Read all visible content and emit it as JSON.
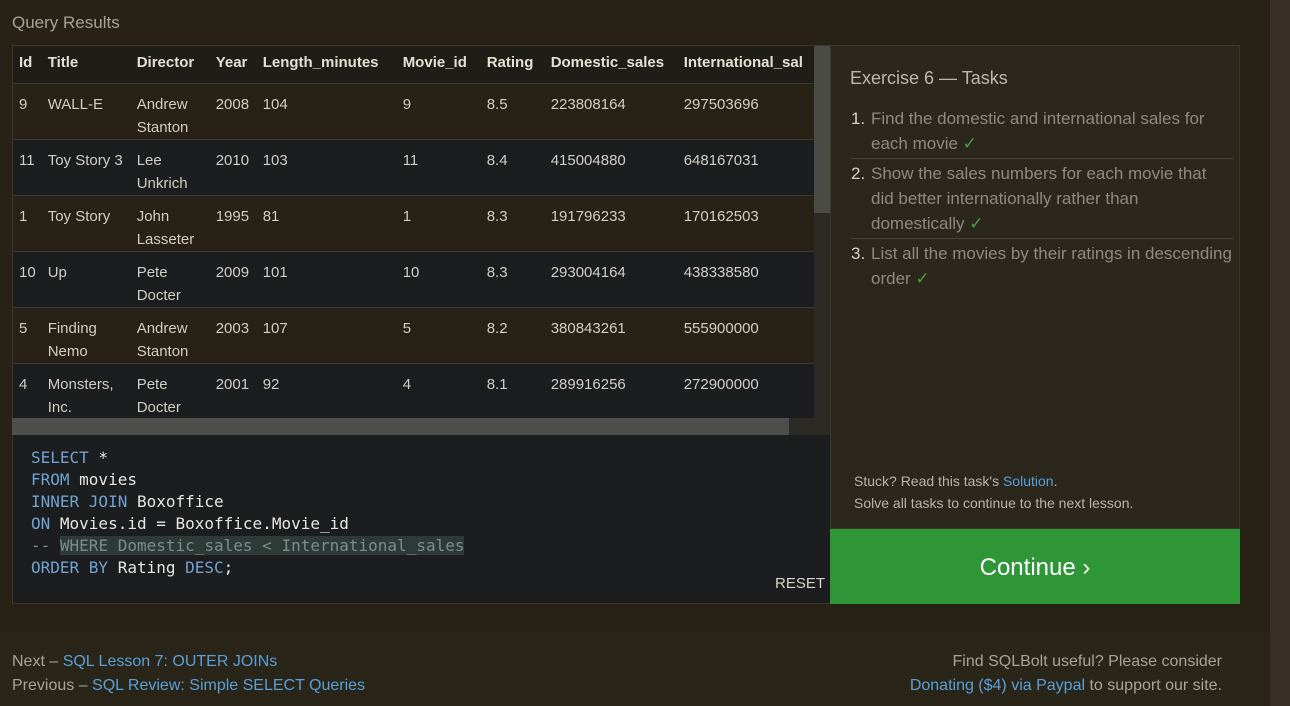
{
  "query_results_title": "Query Results",
  "table": {
    "headers": [
      "Id",
      "Title",
      "Director",
      "Year",
      "Length_minutes",
      "Movie_id",
      "Rating",
      "Domestic_sales",
      "International_sal"
    ],
    "rows": [
      [
        "9",
        "WALL-E",
        "Andrew Stanton",
        "2008",
        "104",
        "9",
        "8.5",
        "223808164",
        "297503696"
      ],
      [
        "11",
        "Toy Story 3",
        "Lee Unkrich",
        "2010",
        "103",
        "11",
        "8.4",
        "415004880",
        "648167031"
      ],
      [
        "1",
        "Toy Story",
        "John Lasseter",
        "1995",
        "81",
        "1",
        "8.3",
        "191796233",
        "170162503"
      ],
      [
        "10",
        "Up",
        "Pete Docter",
        "2009",
        "101",
        "10",
        "8.3",
        "293004164",
        "438338580"
      ],
      [
        "5",
        "Finding Nemo",
        "Andrew Stanton",
        "2003",
        "107",
        "5",
        "8.2",
        "380843261",
        "555900000"
      ],
      [
        "4",
        "Monsters, Inc.",
        "Pete Docter",
        "2001",
        "92",
        "4",
        "8.1",
        "289916256",
        "272900000"
      ]
    ]
  },
  "editor": {
    "lines": {
      "l1_kw": "SELECT",
      "l1_rest": " *",
      "l2_kw": "FROM",
      "l2_rest": " movies",
      "l3_kw": "INNER JOIN",
      "l3_rest": " Boxoffice",
      "l4_kw": "ON",
      "l4_rest": " Movies.id = Boxoffice.Movie_id",
      "l5_comment": "-- ",
      "l5_selected": "WHERE Domestic_sales < International_sales",
      "l6_kw1": "ORDER BY",
      "l6_mid": " Rating ",
      "l6_kw2": "DESC",
      "l6_end": ";"
    },
    "reset_label": "RESET"
  },
  "tasks": {
    "title": "Exercise 6 — Tasks",
    "items": [
      {
        "num": "1.",
        "text": "Find the domestic and international sales for each movie",
        "check": "✓"
      },
      {
        "num": "2.",
        "text": "Show the sales numbers for each movie that did better internationally rather than domestically",
        "check": "✓"
      },
      {
        "num": "3.",
        "text": "List all the movies by their ratings in descending order",
        "check": "✓"
      }
    ],
    "help_prefix": "Stuck? Read this task's ",
    "help_link": "Solution",
    "help_suffix": ".",
    "help_line2": "Solve all tasks to continue to the next lesson."
  },
  "continue_label": "Continue ›",
  "footer": {
    "next_prefix": "Next – ",
    "next_link": "SQL Lesson 7: OUTER JOINs",
    "prev_prefix": "Previous – ",
    "prev_link": "SQL Review: Simple SELECT Queries",
    "right_line1": "Find SQLBolt useful? Please consider",
    "donate_link": "Donating ($4) via Paypal",
    "right_suffix": " to support our site."
  },
  "colors": {
    "accent_green": "#2e9637",
    "link_blue": "#5b9fd8",
    "check_green": "#4f9b4a"
  }
}
